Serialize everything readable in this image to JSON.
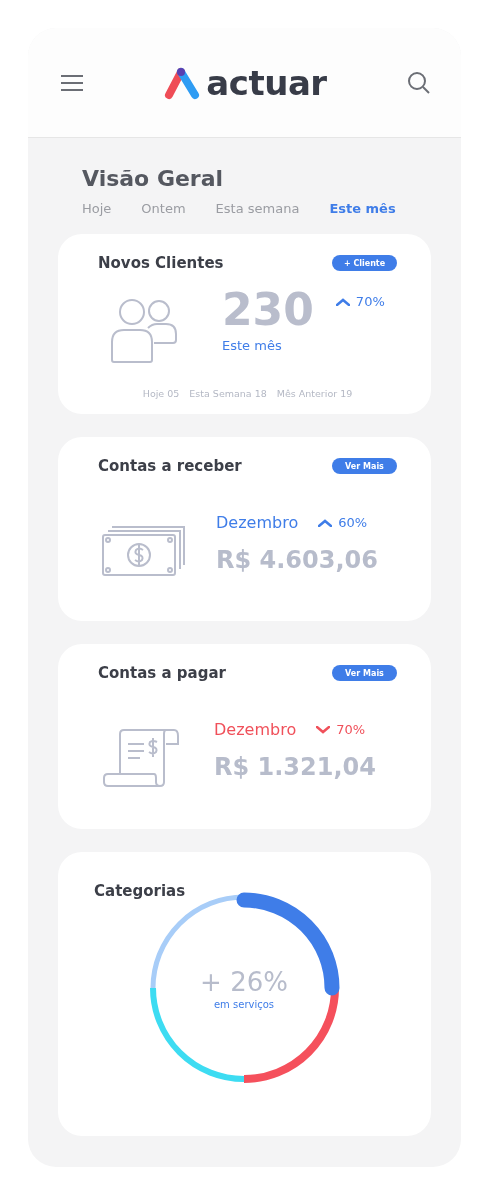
{
  "header": {
    "logo_text": "actuar"
  },
  "page_title": "Visão Geral",
  "periods": [
    {
      "label": "Hoje",
      "selected": false
    },
    {
      "label": "Ontem",
      "selected": false
    },
    {
      "label": "Esta semana",
      "selected": false
    },
    {
      "label": "Este mês",
      "selected": true
    }
  ],
  "new_clients": {
    "title": "Novos Clientes",
    "button": "+ Cliente",
    "count": "230",
    "count_label": "Este mês",
    "trend": {
      "kind": "up",
      "value": "70%"
    },
    "stats": [
      "Hoje 05",
      "Esta Semana 18",
      "Mês Anterior 19"
    ]
  },
  "accounts": [
    {
      "kind": "receivable",
      "title": "Contas a receber",
      "button": "Ver Mais",
      "month": "Dezembro",
      "trend": {
        "kind": "up",
        "value": "60%"
      },
      "amount": "R$ 4.603,06"
    },
    {
      "kind": "payable",
      "title": "Contas a pagar",
      "button": "Ver Mais",
      "month": "Dezembro",
      "trend": {
        "kind": "down",
        "value": "70%"
      },
      "amount": "R$ 1.321,04"
    }
  ],
  "categories": {
    "title": "Categorias",
    "center_value": "+ 26%",
    "center_label": "em serviços"
  }
}
